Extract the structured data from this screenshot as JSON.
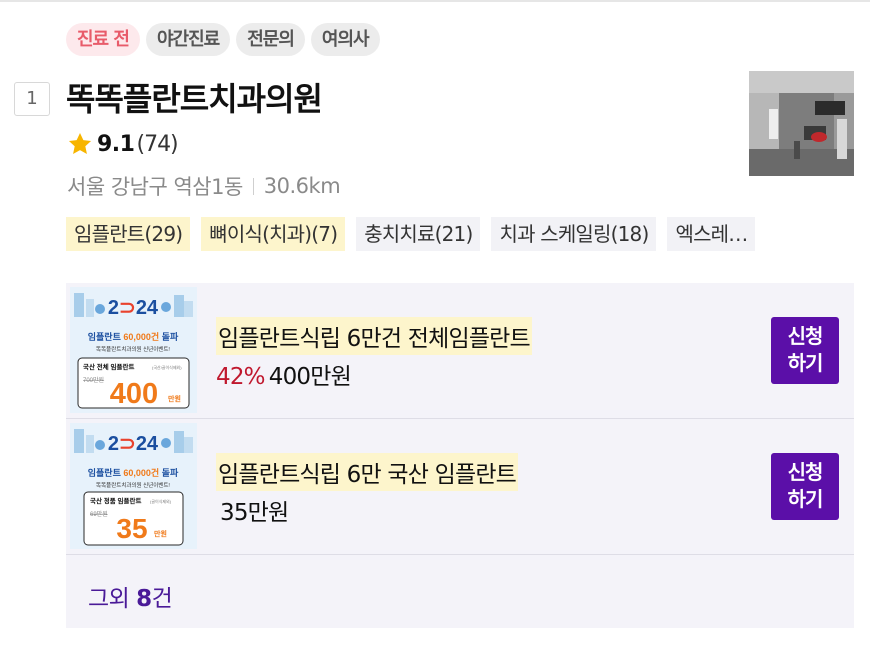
{
  "status_tags": [
    "진료 전",
    "야간진료",
    "전문의",
    "여의사"
  ],
  "rank": "1",
  "clinic": {
    "name": "똑똑플란트치과의원",
    "rating": "9.1",
    "review_count": "(74)",
    "address": "서울 강남구 역삼1동",
    "distance": "30.6km"
  },
  "treatments": [
    {
      "label": "임플란트(29)",
      "highlight": true
    },
    {
      "label": "뼈이식(치과)(7)",
      "highlight": true
    },
    {
      "label": "충치치료(21)",
      "highlight": false
    },
    {
      "label": "치과 스케일링(18)",
      "highlight": false
    },
    {
      "label": "엑스레…",
      "highlight": false
    }
  ],
  "events": [
    {
      "title": "임플란트식립 6만건 전체임플란트",
      "discount": "42%",
      "price": "400만원",
      "apply_line1": "신청",
      "apply_line2": "하기",
      "banner": {
        "year_left": "2",
        "year_right": "24",
        "headline_a": "임플란트",
        "headline_b": "60,000건",
        "headline_c": "돌파",
        "sub": "똑똑플란트치과의원 신년이벤트!",
        "box_label": "국산 전체 임플란트",
        "box_note": "(국산/골이식제외)",
        "old_price": "700만원",
        "big_num": "400",
        "unit": "만원"
      }
    },
    {
      "title": "임플란트식립 6만 국산 임플란트",
      "discount": "",
      "price": "35만원",
      "apply_line1": "신청",
      "apply_line2": "하기",
      "banner": {
        "year_left": "2",
        "year_right": "24",
        "headline_a": "임플란트",
        "headline_b": "60,000건",
        "headline_c": "돌파",
        "sub": "똑똑플란트치과의원 신년이벤트!",
        "box_label": "국산 정품 임플란트",
        "box_note": "(골이식제외)",
        "old_price": "69만원",
        "big_num": "35",
        "unit": "만원"
      }
    }
  ],
  "more": {
    "prefix": "그외 ",
    "count": "8",
    "suffix": "건"
  },
  "colors": {
    "accent": "#5b0fa8",
    "discount": "#c0182e",
    "highlight": "#fdf5cc",
    "star": "#f7b500"
  }
}
